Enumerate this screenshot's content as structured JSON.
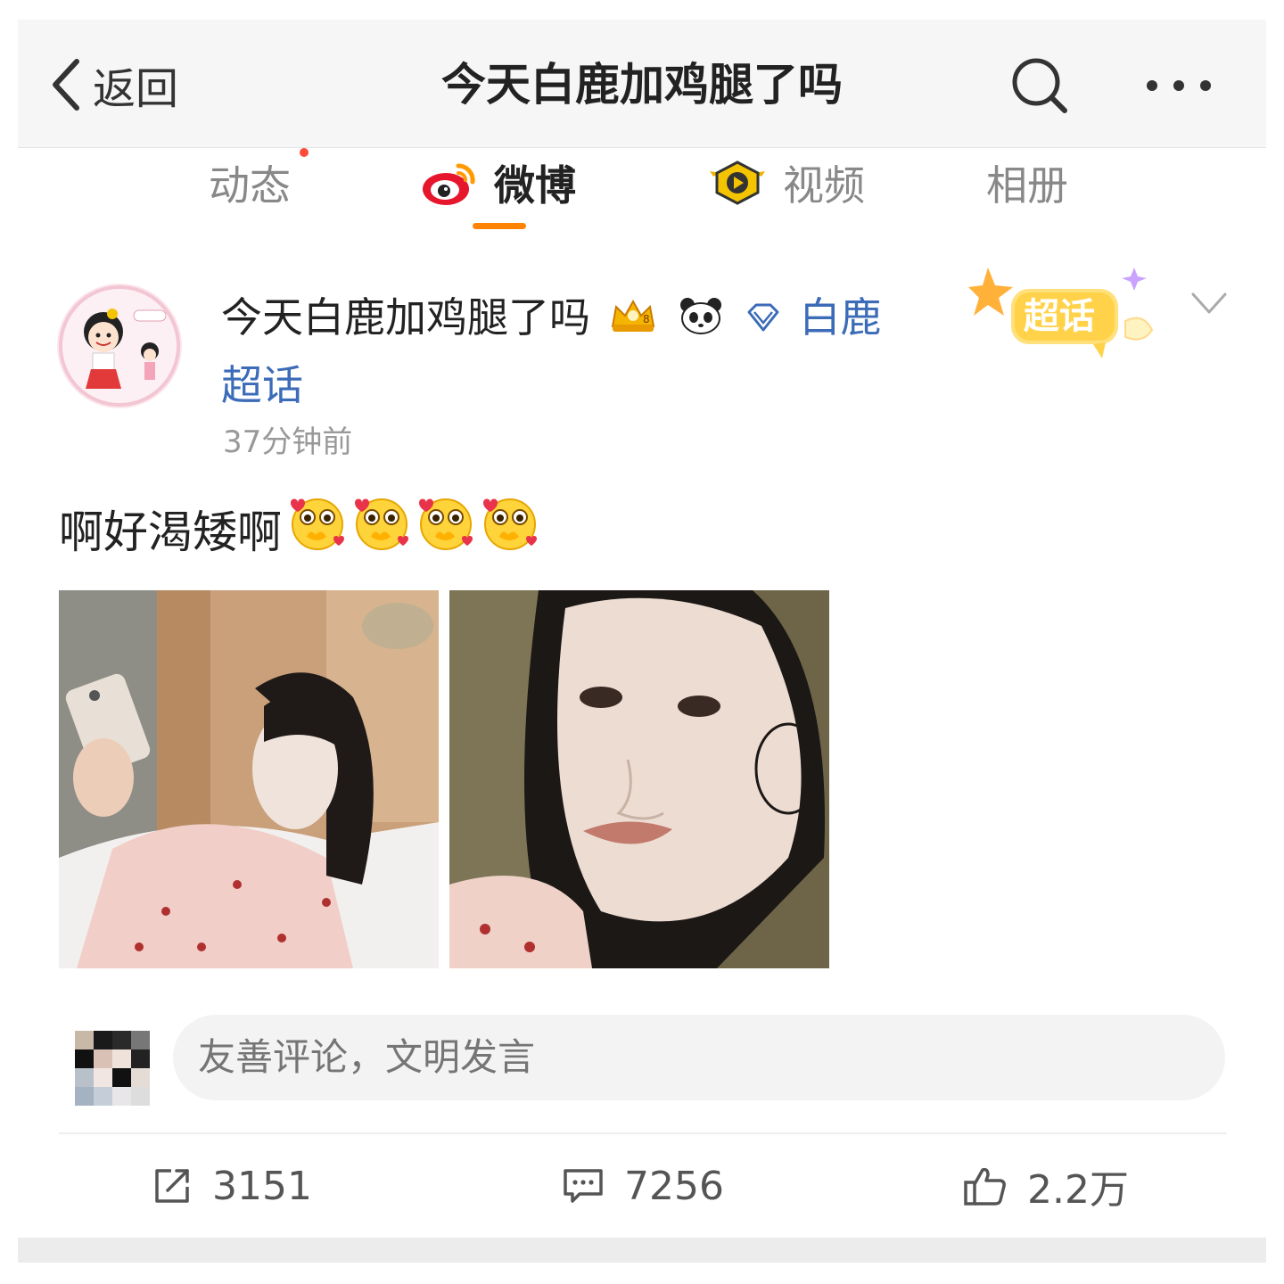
{
  "header": {
    "back_label": "返回",
    "title": "今天白鹿加鸡腿了吗",
    "search_icon": "search-icon",
    "more_icon": "more-icon"
  },
  "tabs": [
    {
      "label": "动态",
      "icon": "",
      "active": false
    },
    {
      "label": "微博",
      "icon": "weibo-logo-icon",
      "active": true
    },
    {
      "label": "视频",
      "icon": "video-play-icon",
      "active": false
    },
    {
      "label": "相册",
      "icon": "",
      "active": false
    }
  ],
  "post": {
    "username": "今天白鹿加鸡腿了吗",
    "supertopic_link_part1": "白鹿",
    "supertopic_link_part2": "超话",
    "timestamp": "37分钟前",
    "supertopic_badge": "超话",
    "text": "啊好渴矮啊",
    "emoji_count": 4,
    "images": [
      "photo-selfie-face-mask",
      "photo-closeup-face-mask"
    ]
  },
  "comment_box": {
    "placeholder": "友善评论，文明发言"
  },
  "actions": {
    "repost_count": "3151",
    "comment_count": "7256",
    "like_count": "2.2万"
  },
  "colors": {
    "accent_orange": "#ff8200",
    "link_blue": "#3c6bb8",
    "header_bg": "#f6f6f6"
  }
}
